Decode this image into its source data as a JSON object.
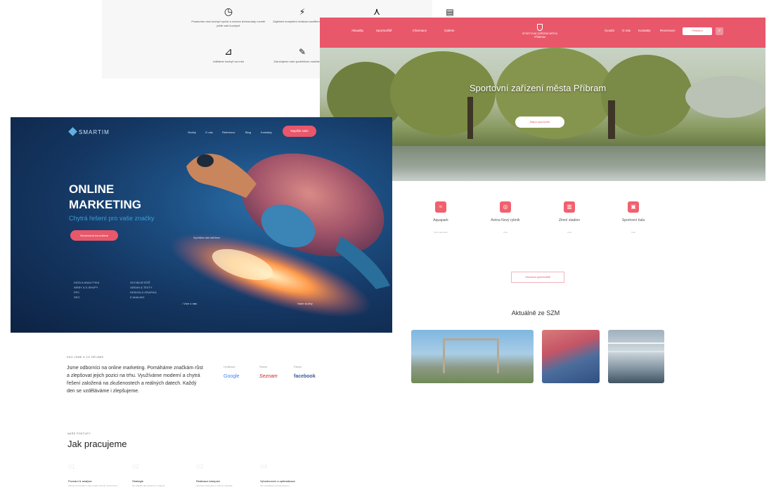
{
  "features": [
    {
      "icon": "clock-icon",
      "glyph": "◷",
      "text": "Postavíme vám kuchyň rychle a vnesou dohromady rozměr ještě vaší kuchyně"
    },
    {
      "icon": "bolt-icon",
      "glyph": "⚡",
      "text": "Zajistíme kompletní realizaci osvětlení kuchyně"
    },
    {
      "icon": "share-icon",
      "glyph": "⋏",
      "text": ""
    },
    {
      "icon": "cabinet-icon",
      "glyph": "▤",
      "text": ""
    },
    {
      "icon": "ruler-icon",
      "glyph": "⊿",
      "text": "Uděláme kuchyň na míru"
    },
    {
      "icon": "wrench-icon",
      "glyph": "✎",
      "text": "Zaručujeme vám spolehlivou montáž kuchyně"
    }
  ],
  "city": {
    "nav": [
      "Aktuality",
      "Sportoviště",
      "Informace",
      "Galerie"
    ],
    "nav_right": [
      "Úvodní",
      "O nás",
      "Kontakty",
      "Rezervace"
    ],
    "logo": "SPORTOVNÍ ZAŘÍZENÍ MĚSTA PŘÍBRAM",
    "login": "Přihlášení",
    "hero_title": "Sportovní zařízení města Příbram",
    "hero_button": "Mapa sportovišť",
    "services": [
      {
        "label": "Aquapark",
        "sub": "Více informací"
      },
      {
        "label": "Aréna Nový rybník",
        "sub": "Více"
      },
      {
        "label": "Zimní stadion",
        "sub": "Více"
      },
      {
        "label": "Sportovní hala",
        "sub": "Více"
      }
    ],
    "more_button": "Všechna sportoviště",
    "news_title": "Aktuálně ze SZM"
  },
  "marketing": {
    "logo": "SMARTIM",
    "nav": [
      "Služby",
      "O nás",
      "Reference",
      "Blog",
      "Kontakty"
    ],
    "cta": "Napište nám",
    "headline_1": "ONLINE",
    "headline_2": "MARKETING",
    "subline": "Chytrá řešení pro vaše značky",
    "button": "Nezávazná konzultace",
    "list_left": [
      "DATA & ANALYTIKA",
      "WEBY & E-SHOPY",
      "PPC",
      "SEO"
    ],
    "list_right": [
      "SOCIÁLNÍ SÍTĚ",
      "OBSAH & TEXTY",
      "DESIGN & GRAFIKA",
      "E-MAILING"
    ],
    "caption": "Zrychlíme vám váš firmu",
    "scroll_left": "Více o nás",
    "scroll_right": "Naše služby",
    "kicker": "KDO JSME A CO DĚLÁME",
    "intro": "Jsme odborníci na online marketing. Pomáháme značkám růst a zlepšovat jejich pozici na trhu. Využíváme moderní a chytrá řešení založená na zkušenostech a reálných datech. Každý den se vzděláváme i zlepšujeme.",
    "clients": [
      {
        "caption": "Certifikace",
        "brand": "Google",
        "color": "#4285f4"
      },
      {
        "caption": "Partner",
        "brand": "Seznam",
        "color": "#cc2222"
      },
      {
        "caption": "Partner",
        "brand": "facebook",
        "color": "#3b5998"
      }
    ],
    "how_kicker": "NAŠE POSTUPY",
    "how_title": "Jak pracujeme",
    "steps": [
      {
        "title": "Poznání & analýza",
        "desc": "Začneme poznáním vaší značky, klientů, konkurence"
      },
      {
        "title": "Strategie",
        "desc": "Na základě dat nastavíme strategii"
      },
      {
        "title": "Realizace kampaní",
        "desc": "Spustíme kampaně a měříme výsledky"
      },
      {
        "title": "Vyhodnocení a optimalizace",
        "desc": "Vše pravidelně vyhodnocujeme"
      }
    ]
  },
  "colors": {
    "accent": "#e9576a",
    "marketing_bg": "#143661",
    "link": "#3e9bd6"
  }
}
